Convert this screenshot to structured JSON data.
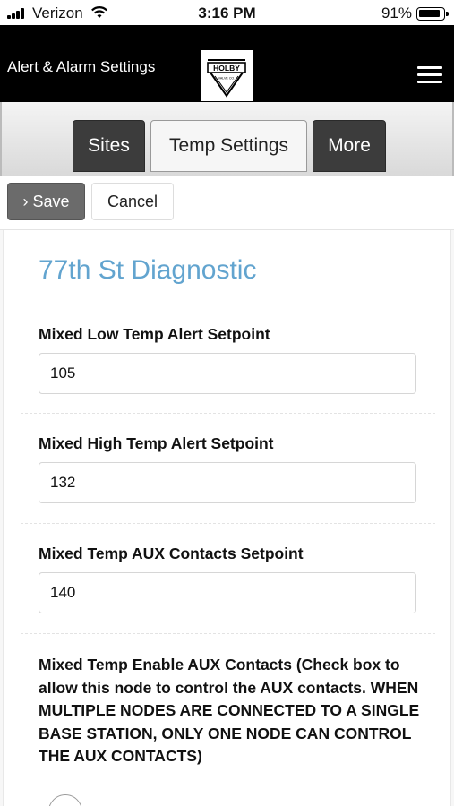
{
  "status_bar": {
    "carrier": "Verizon",
    "time": "3:16 PM",
    "battery_percent": "91%",
    "battery_level": 0.91,
    "signal_icon": "signal-bars-icon",
    "wifi_icon": "wifi-icon"
  },
  "header": {
    "title": "Alert & Alarm Settings",
    "logo_text": "HOLBY",
    "logo_subtext": "VALVE CO.",
    "menu_icon": "hamburger-menu-icon"
  },
  "tabs": [
    {
      "label": "Sites",
      "active": false
    },
    {
      "label": "Temp Settings",
      "active": true
    },
    {
      "label": "More",
      "active": false
    }
  ],
  "actions": {
    "save_prefix": "›",
    "save_label": "Save",
    "cancel_label": "Cancel"
  },
  "form": {
    "site_name": "77th St Diagnostic",
    "fields": [
      {
        "label": "Mixed Low Temp Alert Setpoint",
        "value": "105"
      },
      {
        "label": "Mixed High Temp Alert Setpoint",
        "value": "132"
      },
      {
        "label": "Mixed Temp AUX Contacts Setpoint",
        "value": "140"
      }
    ],
    "aux_enable_label": "Mixed Temp Enable AUX Contacts (Check box to allow this node to control the AUX contacts. WHEN MULTIPLE NODES ARE CONNECTED TO A SINGLE BASE STATION, ONLY ONE NODE CAN CONTROL THE AUX CONTACTS)",
    "aux_enable_checked": false
  },
  "colors": {
    "header_bg": "#000000",
    "tab_dark": "#3c3c3c",
    "save_button": "#6b6b6b",
    "site_title": "#62a4cf"
  }
}
